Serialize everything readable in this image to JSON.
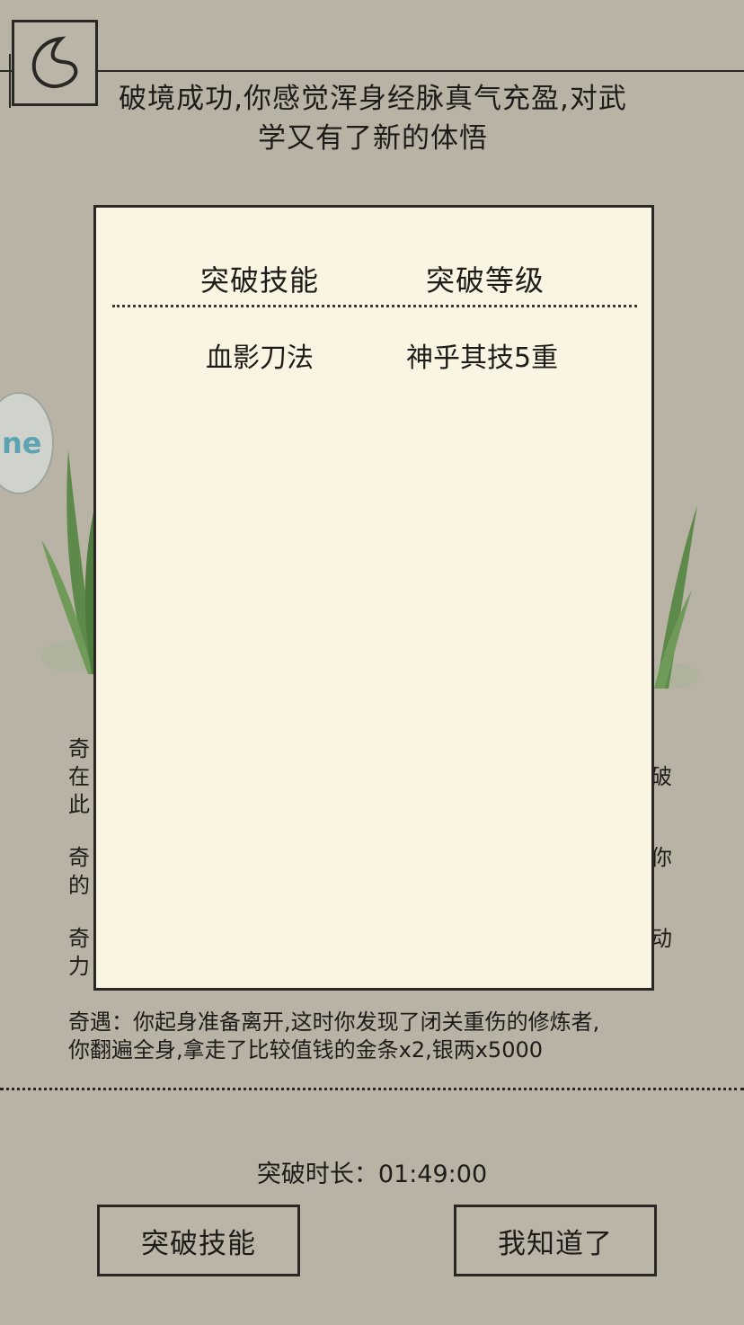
{
  "header": {
    "message": "破境成功,你感觉浑身经脉真气充盈,对武学又有了新的体悟"
  },
  "side_badge": {
    "text": "ne"
  },
  "panel": {
    "columns": [
      "突破技能",
      "突破等级"
    ],
    "rows": [
      {
        "skill": "血影刀法",
        "level": "神乎其技5重"
      }
    ]
  },
  "log": {
    "hidden_lines": [
      "奇",
      "在",
      "此",
      "奇",
      "的",
      "奇",
      "力"
    ],
    "hidden_right": [
      "破",
      "你",
      "动"
    ],
    "visible_line1": "奇遇：你起身准备离开,这时你发现了闭关重伤的修炼者,",
    "visible_line2": "你翻遍全身,拿走了比较值钱的金条x2,银两x5000"
  },
  "footer": {
    "duration_label": "突破时长：01:49:00",
    "skill_button": "突破技能",
    "confirm_button": "我知道了"
  },
  "colors": {
    "background": "#b9b3a6",
    "panel": "#faf4e3",
    "ink": "#1e1c18"
  }
}
